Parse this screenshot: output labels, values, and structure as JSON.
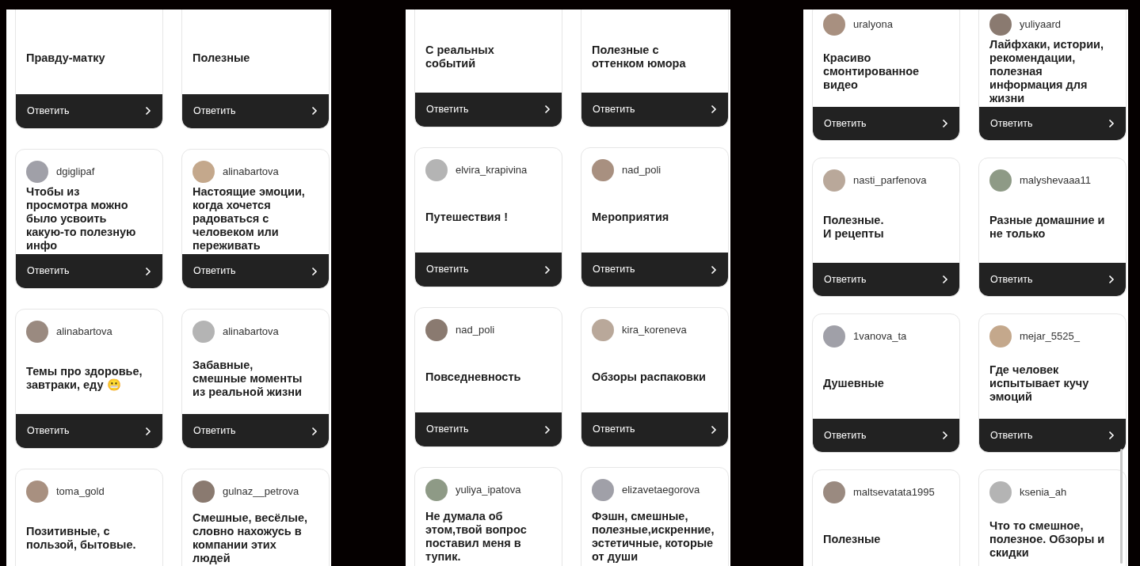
{
  "screens": [
    {
      "cards": [
        {
          "text": "Правду-матку",
          "button": "Ответить"
        },
        {
          "text": "Полезные",
          "button": "Ответить"
        },
        {
          "user": "dgiglipaf",
          "text": "Чтобы из просмотра можно было усвоить какую-то полезную инфо",
          "button": "Ответить"
        },
        {
          "user": "alinabartova",
          "text": "Настоящие эмоции, когда хочется радоваться с человеком или переживать",
          "button": "Ответить"
        },
        {
          "user": "alinabartova",
          "text": "Темы про здоровье, завтраки, еду 😬",
          "button": "Ответить"
        },
        {
          "user": "alinabartova",
          "text": "Забавные, смешные моменты из реальной жизни",
          "button": "Ответить"
        },
        {
          "user": "toma_gold",
          "text": "Позитивные, с пользой, бытовые."
        },
        {
          "user": "gulnaz__petrova",
          "text": "Смешные, весёлые, словно нахожусь в компании этих людей"
        }
      ]
    },
    {
      "cards": [
        {
          "text": "С реальных событий",
          "button": "Ответить"
        },
        {
          "text": "Полезные с оттенком юмора",
          "button": "Ответить"
        },
        {
          "user": "elvira_krapivina",
          "text": "Путешествия !",
          "button": "Ответить"
        },
        {
          "user": "nad_poli",
          "text": "Мероприятия",
          "button": "Ответить"
        },
        {
          "user": "nad_poli",
          "text": "Повседневность",
          "button": "Ответить"
        },
        {
          "user": "kira_koreneva",
          "text": "Обзоры распаковки",
          "button": "Ответить"
        },
        {
          "user": "yuliya_ipatova",
          "text": "Не думала об этом,твой вопрос поставил меня в тупик."
        },
        {
          "user": "elizavetaegorova",
          "text": "Фэшн, смешные, полезные,искренние, эстетичные, которые от души"
        }
      ]
    },
    {
      "cards": [
        {
          "user": "uralyona",
          "text": "Красиво смонтированное видео",
          "button": "Ответить"
        },
        {
          "user": "yuliyaard",
          "text": "Лайфхаки, истории, рекомендации, полезная информация для жизни",
          "button": "Ответить"
        },
        {
          "user": "nasti_parfenova",
          "text": "Полезные.\nИ рецепты",
          "button": "Ответить"
        },
        {
          "user": "malyshevaaa11",
          "text": "Разные домашние и не только",
          "button": "Ответить"
        },
        {
          "user": "1vanova_ta",
          "text": "Душевные",
          "button": "Ответить"
        },
        {
          "user": "mejar_5525_",
          "text": "Где человек испытывает кучу эмоций",
          "button": "Ответить"
        },
        {
          "user": "maltsevatata1995",
          "text": "Полезные"
        },
        {
          "user": "ksenia_ah",
          "text": "Что то смешное, полезное. Обзоры и скидки"
        }
      ]
    }
  ]
}
